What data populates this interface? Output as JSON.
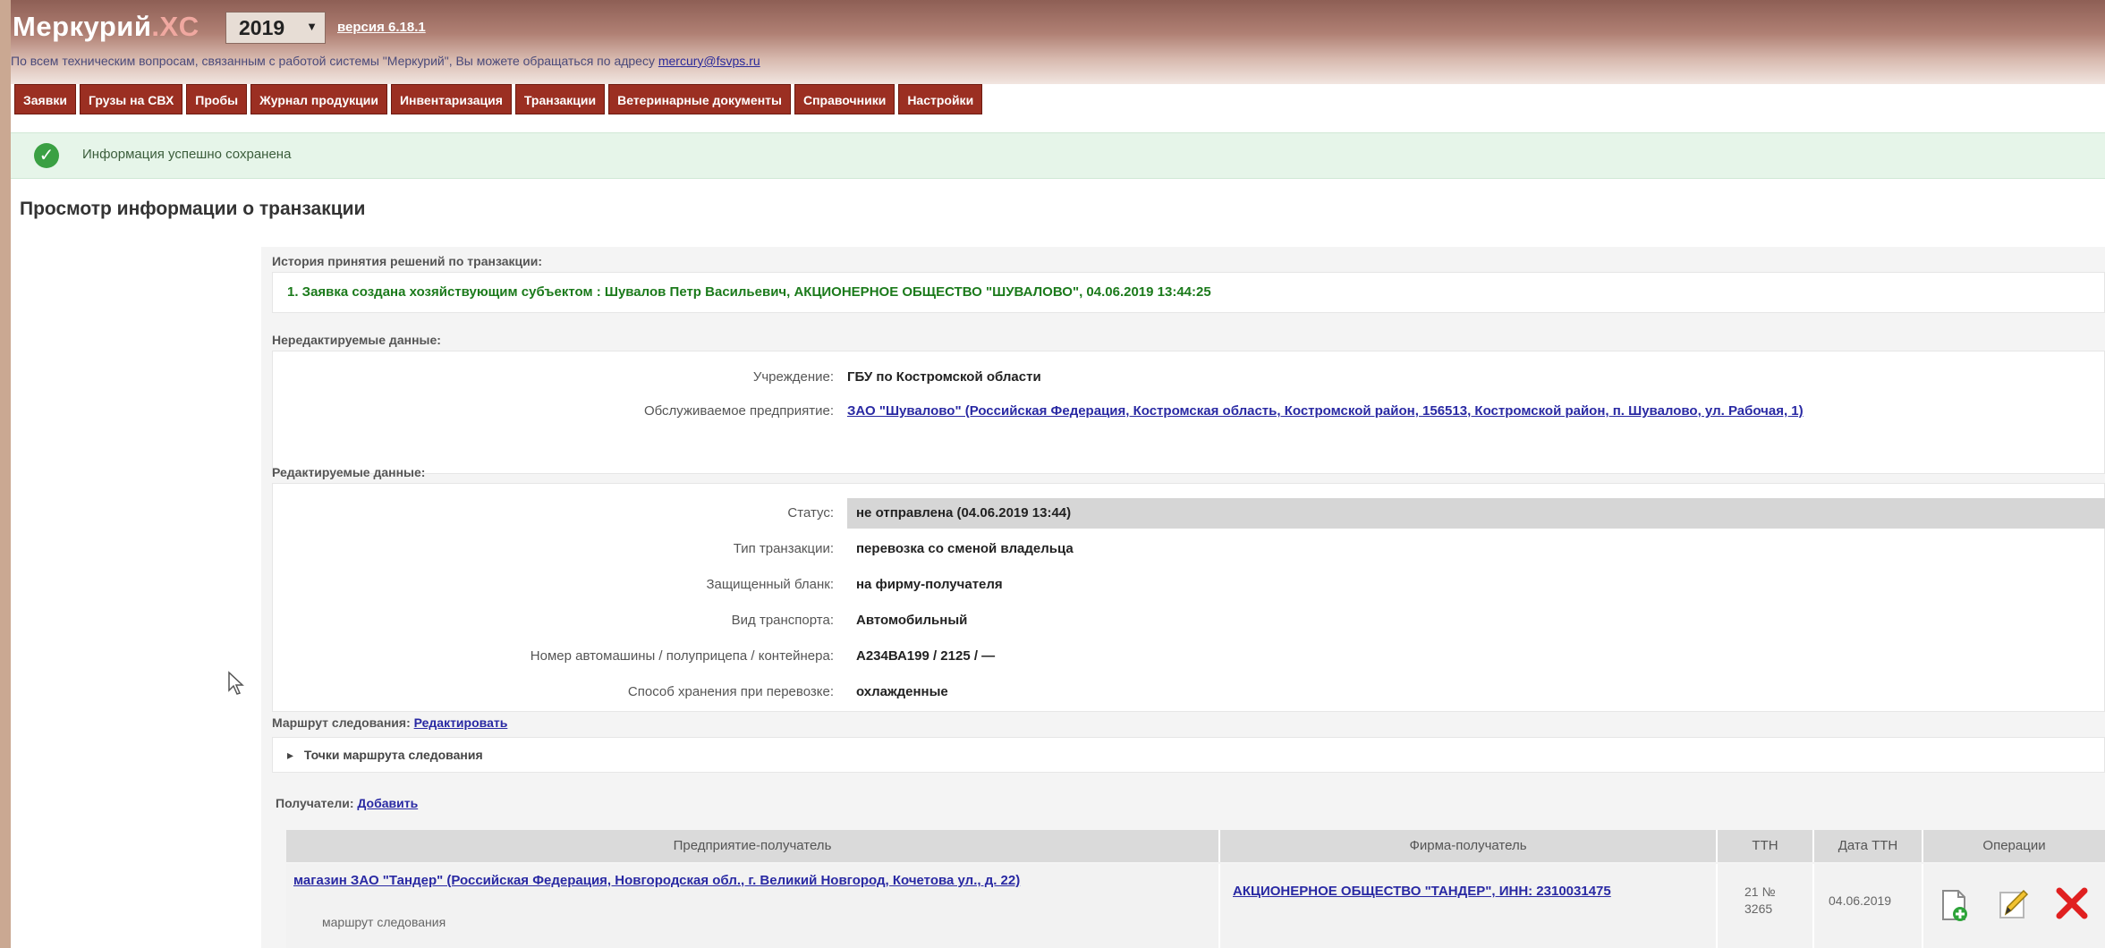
{
  "app": {
    "logo_main": "Меркурий",
    "logo_suffix": ".XC",
    "year": "2019",
    "version": "версия 6.18.1",
    "support_text": "По всем техническим вопросам, связанным с работой системы \"Меркурий\", Вы можете обращаться по адресу",
    "support_email": "mercury@fsvps.ru"
  },
  "menu": [
    "Заявки",
    "Грузы на СВХ",
    "Пробы",
    "Журнал продукции",
    "Инвентаризация",
    "Транзакции",
    "Ветеринарные документы",
    "Справочники",
    "Настройки"
  ],
  "success_message": "Информация успешно сохранена",
  "page_title": "Просмотр информации о транзакции",
  "history": {
    "label": "История принятия решений по транзакции:",
    "items": [
      "1. Заявка создана хозяйствующим субъектом : Шувалов Петр Васильевич, АКЦИОНЕРНОЕ ОБЩЕСТВО \"ШУВАЛОВО\", 04.06.2019 13:44:25"
    ]
  },
  "noneditable": {
    "label": "Нередактируемые данные:",
    "institution_label": "Учреждение:",
    "institution_value": "ГБУ по Костромской области",
    "enterprise_label": "Обслуживаемое предприятие:",
    "enterprise_value": "ЗАО \"Шувалово\" (Российская Федерация, Костромская область, Костромской район, 156513, Костромской район, п. Шувалово, ул. Рабочая, 1)"
  },
  "editable": {
    "label": "Редактируемые данные:",
    "rows": [
      {
        "label": "Статус:",
        "value": "не отправлена (04.06.2019 13:44)"
      },
      {
        "label": "Тип транзакции:",
        "value": "перевозка со сменой владельца"
      },
      {
        "label": "Защищенный бланк:",
        "value": "на фирму-получателя"
      },
      {
        "label": "Вид транспорта:",
        "value": "Автомобильный"
      },
      {
        "label": "Номер автомашины / полуприцепа / контейнера:",
        "value": "А234ВА199 / 2125 / —"
      },
      {
        "label": "Способ хранения при перевозке:",
        "value": "охлажденные"
      }
    ]
  },
  "route": {
    "label": "Маршрут следования:",
    "edit_link": "Редактировать",
    "points_toggle": "Точки маршрута следования"
  },
  "recipients": {
    "label": "Получатели:",
    "add_link": "Добавить",
    "columns": [
      "Предприятие-получатель",
      "Фирма-получатель",
      "ТТН",
      "Дата ТТН",
      "Операции"
    ],
    "rows": [
      {
        "enterprise": "магазин ЗАО \"Тандер\" (Российская Федерация, Новгородская обл., г. Великий Новгород, Кочетова ул., д. 22)",
        "route_note": "маршрут следования",
        "firm": "АКЦИОНЕРНОЕ ОБЩЕСТВО \"ТАНДЕР\", ИНН: 2310031475",
        "ttn": "21 № 3265",
        "ttn_date": "04.06.2019"
      }
    ]
  },
  "icons": {
    "success": "check-circle-icon",
    "add_doc": "document-add-icon",
    "edit": "pencil-icon",
    "delete": "red-x-icon",
    "cursor": "mouse-cursor-icon"
  },
  "colors": {
    "menu_bg": "#9b2f22",
    "success_bg": "#e6f5e9",
    "link": "#2929a3",
    "history_green": "#1b7a1b"
  }
}
